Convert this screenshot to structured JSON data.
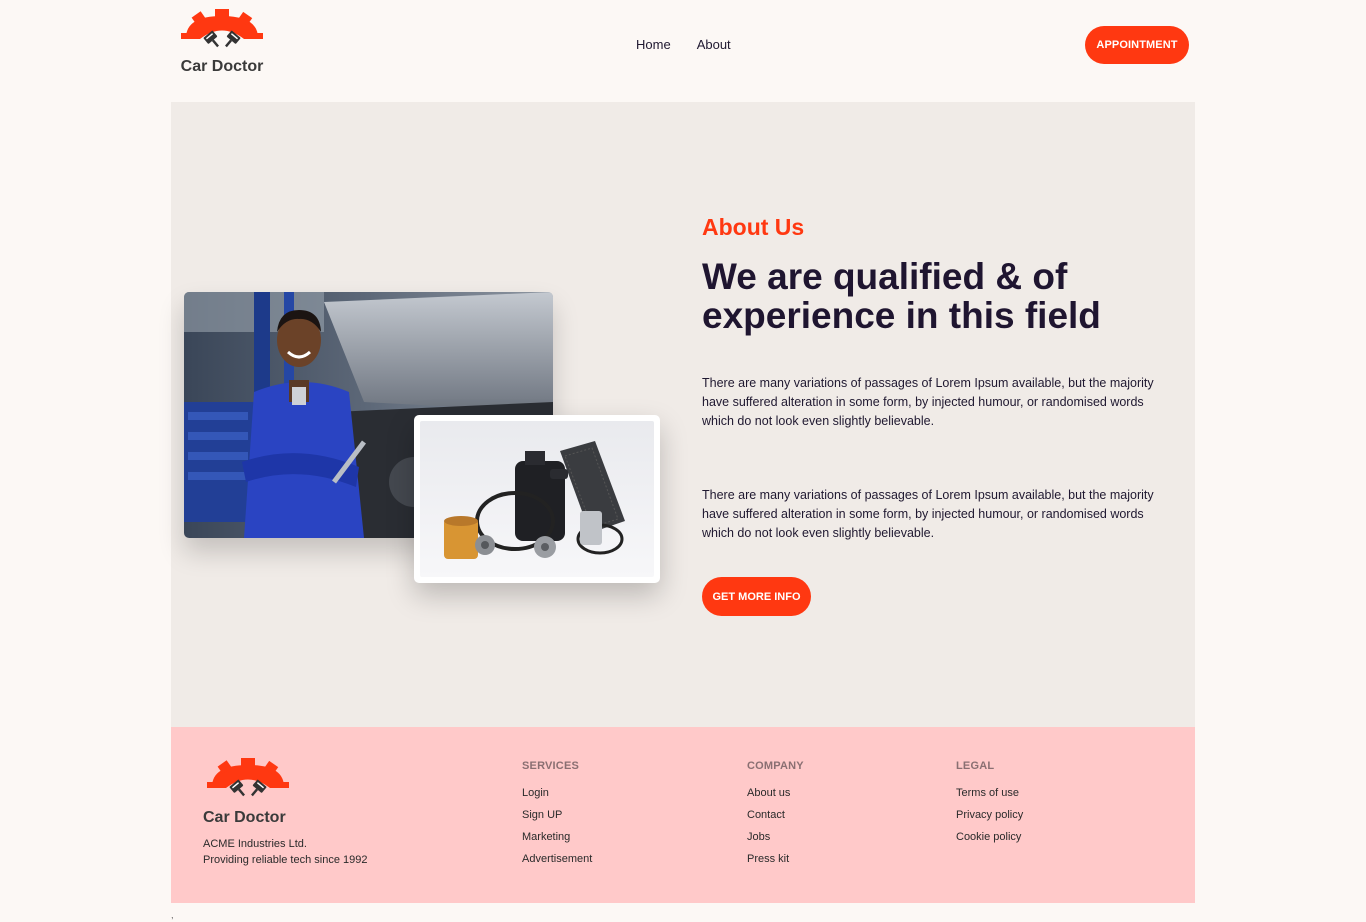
{
  "brand": {
    "name": "Car Doctor",
    "accent": "#ff3811"
  },
  "nav": {
    "items": [
      {
        "label": "Home"
      },
      {
        "label": "About"
      }
    ],
    "cta": "Appointment"
  },
  "about": {
    "kicker": "About Us",
    "headline": "We are qualified & of experience in this field",
    "paragraphs": [
      "There are many variations of passages of Lorem Ipsum available, but the majority have suffered alteration in some form, by injected humour, or randomised words which do not look even slightly believable.",
      "There are many variations of passages of Lorem Ipsum available, but the majority have suffered alteration in some form, by injected humour, or randomised words which do not look even slightly believable."
    ],
    "cta": "Get More Info"
  },
  "footer": {
    "brand": "Car Doctor",
    "tagline_1": "ACME Industries Ltd.",
    "tagline_2": "Providing reliable tech since 1992",
    "columns": [
      {
        "title": "SERVICES",
        "links": [
          "Login",
          "Sign UP",
          "Marketing",
          "Advertisement"
        ]
      },
      {
        "title": "COMPANY",
        "links": [
          "About us",
          "Contact",
          "Jobs",
          "Press kit"
        ]
      },
      {
        "title": "LEGAL",
        "links": [
          "Terms of use",
          "Privacy policy",
          "Cookie policy"
        ]
      }
    ]
  },
  "colors": {
    "page_bg": "#fcf8f5",
    "section_bg": "#f0ebe7",
    "footer_bg": "#ffc9c9",
    "heading": "#1f1530"
  },
  "stray_mark": ","
}
